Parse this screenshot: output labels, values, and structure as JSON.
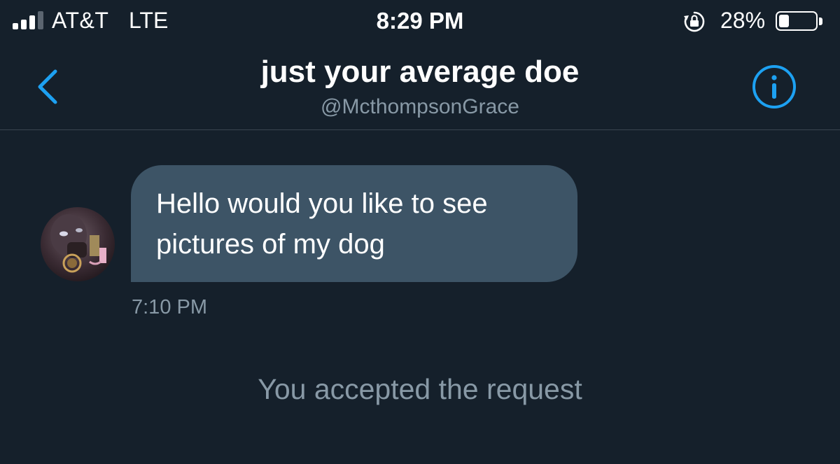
{
  "status_bar": {
    "carrier": "AT&T",
    "network": "LTE",
    "time": "8:29 PM",
    "battery_percent_text": "28%",
    "battery_level": 0.28,
    "signal_bars_filled": 3,
    "signal_bars_total": 4,
    "icons": [
      "signal-icon",
      "rotation-lock-icon",
      "battery-icon"
    ]
  },
  "header": {
    "title": "just your average doe",
    "handle": "@McthompsonGrace",
    "icons": [
      "back-chevron-icon",
      "info-icon"
    ]
  },
  "conversation": {
    "messages": [
      {
        "lines": [
          "Hello would you like to see",
          "pictures of my dog"
        ],
        "time": "7:10 PM"
      }
    ],
    "system_note": "You accepted the request"
  },
  "colors": {
    "background": "#15202b",
    "accent": "#1da1f2",
    "bubble": "#3d5466",
    "secondary_text": "#8899a6"
  }
}
